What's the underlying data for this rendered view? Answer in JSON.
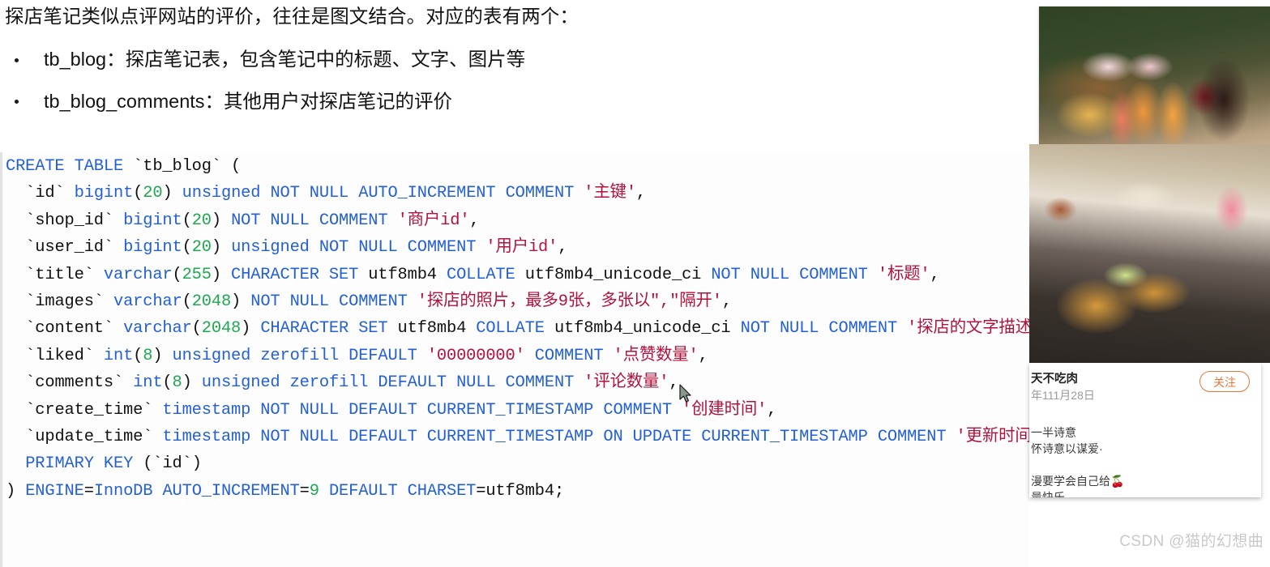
{
  "prose": {
    "lead": "探店笔记类似点评网站的评价，往往是图文结合。对应的表有两个：",
    "bullets": [
      "tb_blog：探店笔记表，包含笔记中的标题、文字、图片等",
      "tb_blog_comments：其他用户对探店笔记的评价"
    ]
  },
  "code": {
    "language": "sql",
    "lines": [
      "CREATE TABLE `tb_blog` (",
      "  `id` bigint(20) unsigned NOT NULL AUTO_INCREMENT COMMENT '主键',",
      "  `shop_id` bigint(20) NOT NULL COMMENT '商户id',",
      "  `user_id` bigint(20) unsigned NOT NULL COMMENT '用户id',",
      "  `title` varchar(255) CHARACTER SET utf8mb4 COLLATE utf8mb4_unicode_ci NOT NULL COMMENT '标题',",
      "  `images` varchar(2048) NOT NULL COMMENT '探店的照片，最多9张，多张以\",\"隔开',",
      "  `content` varchar(2048) CHARACTER SET utf8mb4 COLLATE utf8mb4_unicode_ci NOT NULL COMMENT '探店的文字描述',",
      "  `liked` int(8) unsigned zerofill DEFAULT '00000000' COMMENT '点赞数量',",
      "  `comments` int(8) unsigned zerofill DEFAULT NULL COMMENT '评论数量',",
      "  `create_time` timestamp NOT NULL DEFAULT CURRENT_TIMESTAMP COMMENT '创建时间',",
      "  `update_time` timestamp NOT NULL DEFAULT CURRENT_TIMESTAMP ON UPDATE CURRENT_TIMESTAMP COMMENT '更新时间',",
      "  PRIMARY KEY (`id`)",
      ") ENGINE=InnoDB AUTO_INCREMENT=9 DEFAULT CHARSET=utf8mb4;"
    ],
    "colors": {
      "keyword": "#2360d8",
      "number": "#1ea84f",
      "string": "#b2123b",
      "plain": "#111111",
      "background": "#fdfdfd"
    }
  },
  "photos": [
    {
      "alt": "户外餐桌鲜花与酒瓶"
    },
    {
      "alt": "烤鱼与意面餐盘"
    }
  ],
  "card": {
    "username": "天不吃肉",
    "date": "年111月28日",
    "follow_label": "关注",
    "body_lines": [
      "一半诗意",
      "怀诗意以谋爱·",
      "",
      "漫要学会自己给🍒",
      "量快乐."
    ]
  },
  "watermark": "CSDN @猫的幻想曲",
  "accents": {
    "follow_border": "#e8763b",
    "bottom_strip": "#c5161c",
    "watermark_color": "#c9c9c9"
  }
}
